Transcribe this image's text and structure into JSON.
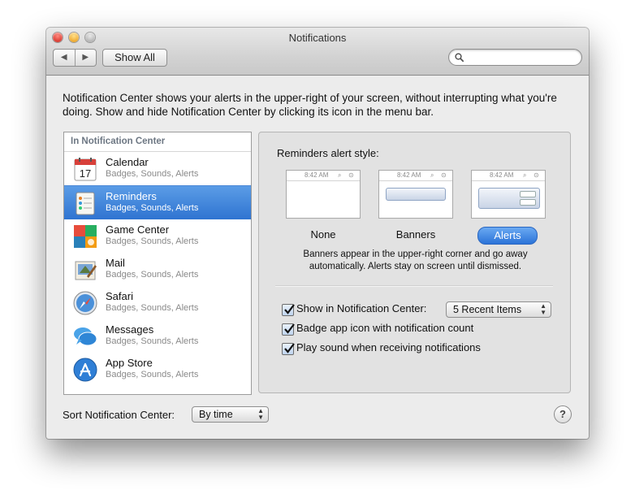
{
  "window": {
    "title": "Notifications"
  },
  "toolbar": {
    "back_glyph": "◀",
    "forward_glyph": "▶",
    "show_all_label": "Show All",
    "search_placeholder": ""
  },
  "description": "Notification Center shows your alerts in the upper-right of your screen, without interrupting what you're doing. Show and hide Notification Center by clicking its icon in the menu bar.",
  "app_list": {
    "header": "In Notification Center",
    "items": [
      {
        "name": "Calendar",
        "subtitle": "Badges, Sounds, Alerts",
        "icon": "calendar-icon",
        "calendar_day": "17"
      },
      {
        "name": "Reminders",
        "subtitle": "Badges, Sounds, Alerts",
        "icon": "reminders-icon",
        "selected": true
      },
      {
        "name": "Game Center",
        "subtitle": "Badges, Sounds, Alerts",
        "icon": "game-center-icon"
      },
      {
        "name": "Mail",
        "subtitle": "Badges, Sounds, Alerts",
        "icon": "mail-icon"
      },
      {
        "name": "Safari",
        "subtitle": "Badges, Sounds, Alerts",
        "icon": "safari-icon"
      },
      {
        "name": "Messages",
        "subtitle": "Badges, Sounds, Alerts",
        "icon": "messages-icon"
      },
      {
        "name": "App Store",
        "subtitle": "Badges, Sounds, Alerts",
        "icon": "app-store-icon"
      }
    ]
  },
  "alert_style": {
    "label": "Reminders alert style:",
    "preview_time": "8:42 AM",
    "options": [
      {
        "label": "None"
      },
      {
        "label": "Banners"
      },
      {
        "label": "Alerts",
        "selected": true
      }
    ],
    "help_text": "Banners appear in the upper-right corner and go away automatically. Alerts stay on screen until dismissed."
  },
  "options": {
    "show_in_nc": {
      "label": "Show in Notification Center:",
      "checked": true
    },
    "recent_items": {
      "value": "5 Recent Items"
    },
    "badge": {
      "label": "Badge app icon with notification count",
      "checked": true
    },
    "sound": {
      "label": "Play sound when receiving notifications",
      "checked": true
    }
  },
  "sort": {
    "label": "Sort Notification Center:",
    "value": "By time"
  },
  "help_button": {
    "label": "?"
  },
  "colors": {
    "selection": "#2f74d1",
    "pill": "#2b73d8"
  }
}
